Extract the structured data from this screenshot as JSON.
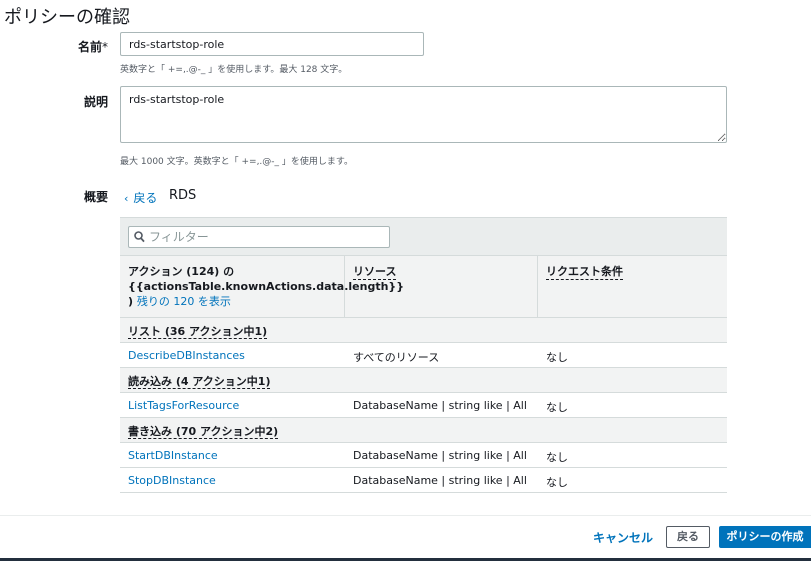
{
  "page": {
    "title": "ポリシーの確認"
  },
  "name_field": {
    "label": "名前",
    "required_mark": "*",
    "value": "rds-startstop-role",
    "hint": "英数字と「 +=,.@-_ 」を使用します。最大 128 文字。"
  },
  "description_field": {
    "label": "説明",
    "value": "rds-startstop-role",
    "hint": "最大 1000 文字。英数字と「 +=,.@-_ 」を使用します。"
  },
  "summary": {
    "label": "概要",
    "back_link": "戻る",
    "service": "RDS"
  },
  "table": {
    "filter_placeholder": "フィルター",
    "columns": {
      "action_title": "アクション (124) の {{actionsTable.knownActions.data.length}} )",
      "show_more": "残りの 120 を表示",
      "resource": "リソース",
      "condition": "リクエスト条件"
    },
    "groups": [
      {
        "name": "リスト (36 アクション中1)",
        "rows": [
          {
            "action": "DescribeDBInstances",
            "resource": "すべてのリソース",
            "condition": "なし"
          }
        ]
      },
      {
        "name": "読み込み (4 アクション中1)",
        "rows": [
          {
            "action": "ListTagsForResource",
            "resource": "DatabaseName | string like | All",
            "condition": "なし"
          }
        ]
      },
      {
        "name": "書き込み (70 アクション中2)",
        "rows": [
          {
            "action": "StartDBInstance",
            "resource": "DatabaseName | string like | All",
            "condition": "なし"
          },
          {
            "action": "StopDBInstance",
            "resource": "DatabaseName | string like | All",
            "condition": "なし"
          }
        ]
      }
    ]
  },
  "footer": {
    "cancel": "キャンセル",
    "back": "戻る",
    "create": "ポリシーの作成"
  },
  "colors": {
    "link": "#0073bb",
    "primary_button": "#0073bb",
    "header_bg": "#f2f3f3"
  }
}
